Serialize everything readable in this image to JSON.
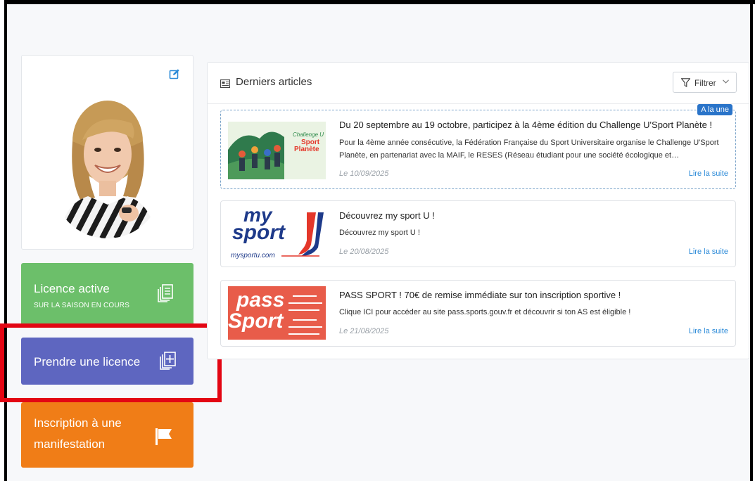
{
  "profile": {
    "edit_icon": "edit-icon",
    "avatar_icon": "user-avatar-photo"
  },
  "tiles": {
    "licence_active": {
      "title": "Licence active",
      "subtitle": "SUR LA SAISON EN COURS",
      "icon": "documents-icon"
    },
    "prendre_licence": {
      "title": "Prendre une licence",
      "icon": "add-document-icon"
    },
    "inscription": {
      "title_line1": "Inscription à une",
      "title_line2": "manifestation",
      "icon": "flag-icon"
    }
  },
  "articles": {
    "header_title": "Derniers articles",
    "header_icon": "newspaper-icon",
    "filter_label": "Filtrer",
    "items": [
      {
        "badge": "A la une",
        "title": "Du 20 septembre au 19 octobre, participez à la 4ème édition du Challenge U'Sport Planète !",
        "excerpt": "Pour la 4ème année consécutive, la Fédération Française du Sport Universitaire organise le Challenge U'Sport Planète, en partenariat avec la MAIF, le RESES (Réseau étudiant pour une société écologique et…",
        "date": "Le 10/09/2025",
        "link": "Lire la suite",
        "thumb_text": [
          "Challenge U",
          "Sport",
          "Planète"
        ]
      },
      {
        "title": "Découvrez my sport U !",
        "excerpt": "Découvrez my sport U !",
        "date": "Le 20/08/2025",
        "link": "Lire la suite",
        "thumb_text": [
          "my",
          "sport",
          "mysportu.com"
        ]
      },
      {
        "title": "PASS SPORT ! 70€ de remise immédiate sur ton inscription sportive !",
        "excerpt": "Clique ICI pour accéder au site pass.sports.gouv.fr et découvrir si ton AS est éligible !",
        "date": "Le 21/08/2025",
        "link": "Lire la suite",
        "thumb_text": [
          "pass",
          "Sport"
        ]
      }
    ]
  },
  "colors": {
    "licence_active": "#6cbf6a",
    "prendre_licence": "#5e66c0",
    "inscription": "#f07d17",
    "link": "#2b8ad8",
    "badge": "#2a74c9",
    "highlight": "#e30613"
  }
}
